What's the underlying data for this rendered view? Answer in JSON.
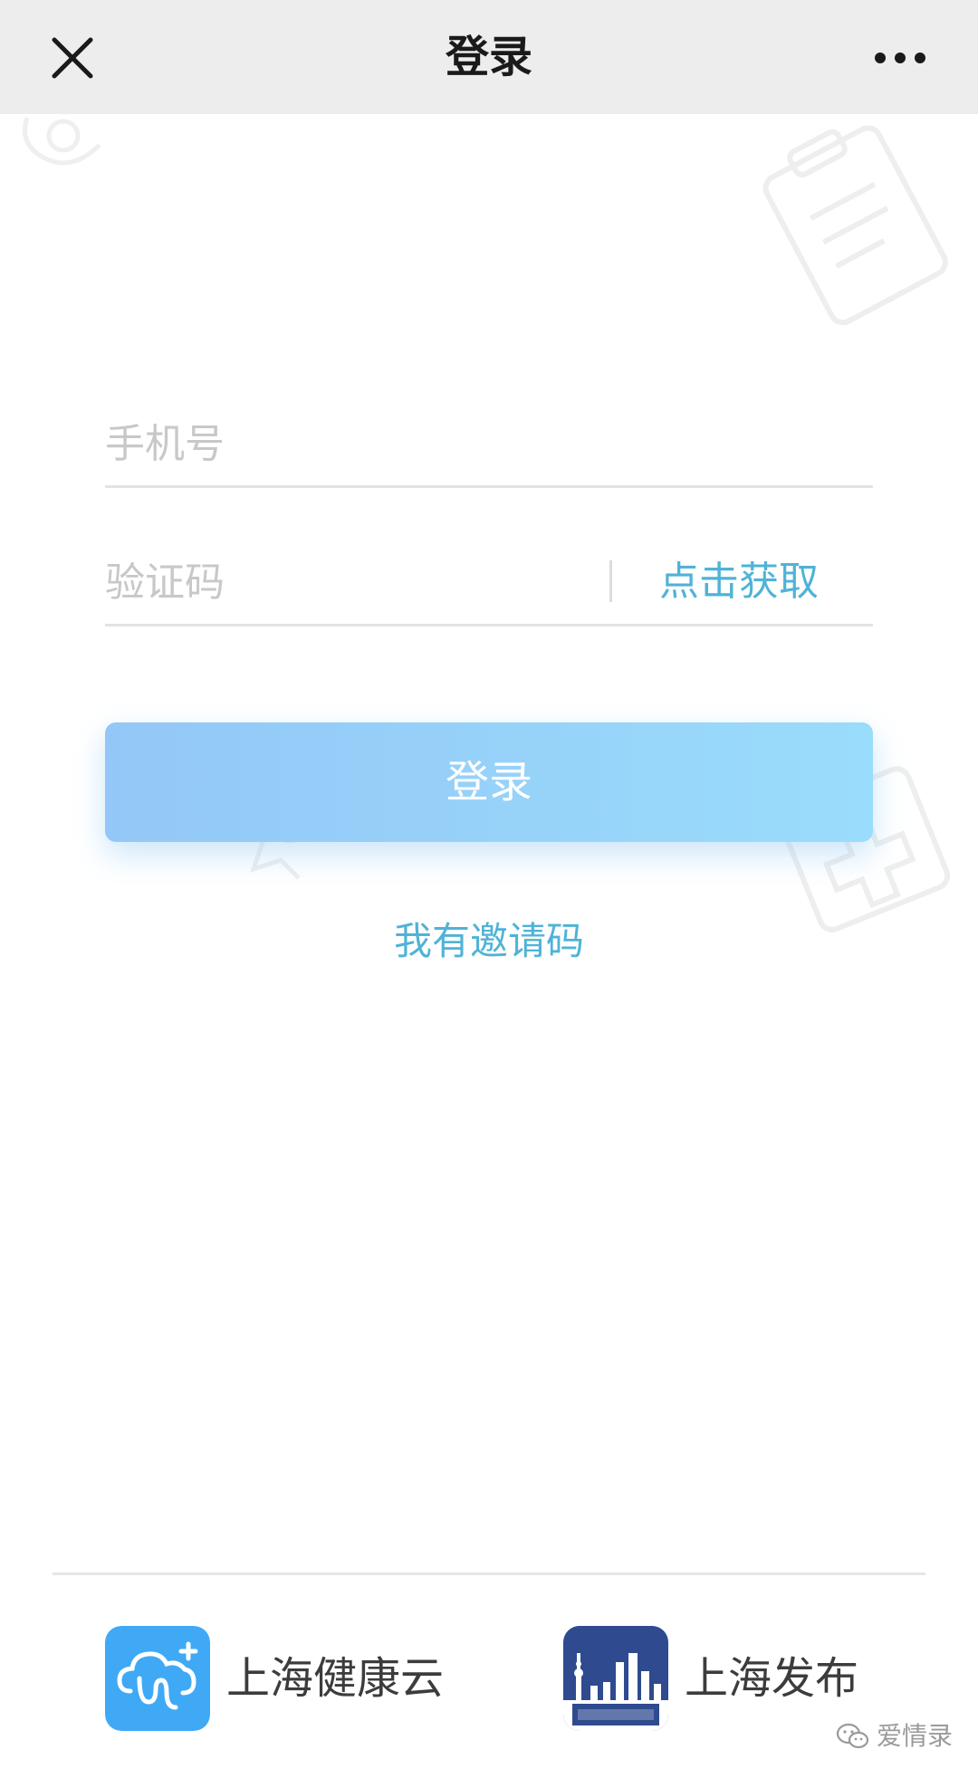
{
  "navbar": {
    "title": "登录",
    "close_icon": "close-icon",
    "more_icon": "more-icon"
  },
  "form": {
    "phone_placeholder": "手机号",
    "code_placeholder": "验证码",
    "get_code_label": "点击获取",
    "login_label": "登录",
    "invite_label": "我有邀请码"
  },
  "partners": [
    {
      "name": "上海健康云",
      "icon": "cloud-plus-icon"
    },
    {
      "name": "上海发布",
      "icon": "shanghai-skyline-logo"
    }
  ],
  "watermark": {
    "text": "爱情录",
    "icon": "wechat-icon"
  },
  "colors": {
    "accent": "#4fb3d6",
    "button_start": "#93c7f7",
    "button_end": "#9adcfb",
    "navbar_bg": "#ededed",
    "health_logo": "#3fa9f5",
    "publish_logo": "#2f4a8f"
  }
}
